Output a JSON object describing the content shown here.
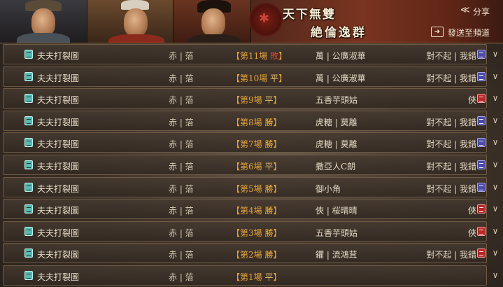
{
  "header": {
    "slogan_line1": "天下無雙",
    "slogan_line2": "絶倫逸群",
    "share_label": "分享",
    "send_label": "發送至頻道",
    "seal_glyph": "✱",
    "share_icon": "share-icon",
    "send_icon": "send-to-channel-icon"
  },
  "portraits": [
    "portrait-general-1",
    "portrait-general-2",
    "portrait-general-3"
  ],
  "rows": [
    {
      "name": "夫夫打裂圖",
      "host": "赤 | 菭",
      "match_prefix": "【第11場 ",
      "result": "敗",
      "result_type": "lose",
      "match_suffix": "】",
      "opponent": "萬 | 公廣淑華",
      "reply": "對不起 | 我錯",
      "badge": "blue"
    },
    {
      "name": "夫夫打裂圖",
      "host": "赤 | 菭",
      "match_prefix": "【第10場 ",
      "result": "平",
      "result_type": "draw",
      "match_suffix": "】",
      "opponent": "萬 | 公廣淑華",
      "reply": "對不起 | 我錯",
      "badge": "blue"
    },
    {
      "name": "夫夫打裂圖",
      "host": "赤 | 菭",
      "match_prefix": "【第9場 ",
      "result": "平",
      "result_type": "draw",
      "match_suffix": "】",
      "opponent": "五香芋頭姑",
      "reply": "俠",
      "badge": "red"
    },
    {
      "name": "夫夫打裂圖",
      "host": "赤 | 菭",
      "match_prefix": "【第8場 ",
      "result": "勝",
      "result_type": "win",
      "match_suffix": "】",
      "opponent": "虎糖 | 莫離",
      "reply": "對不起 | 我錯",
      "badge": "blue"
    },
    {
      "name": "夫夫打裂圖",
      "host": "赤 | 菭",
      "match_prefix": "【第7場 ",
      "result": "勝",
      "result_type": "win",
      "match_suffix": "】",
      "opponent": "虎糖 | 莫離",
      "reply": "對不起 | 我錯",
      "badge": "blue"
    },
    {
      "name": "夫夫打裂圖",
      "host": "赤 | 菭",
      "match_prefix": "【第6場 ",
      "result": "平",
      "result_type": "draw",
      "match_suffix": "】",
      "opponent": "撒亞人C朗",
      "reply": "對不起 | 我錯",
      "badge": "blue"
    },
    {
      "name": "夫夫打裂圖",
      "host": "赤 | 菭",
      "match_prefix": "【第5場 ",
      "result": "勝",
      "result_type": "win",
      "match_suffix": "】",
      "opponent": "御小角",
      "reply": "對不起 | 我錯",
      "badge": "blue"
    },
    {
      "name": "夫夫打裂圖",
      "host": "赤 | 菭",
      "match_prefix": "【第4場 ",
      "result": "勝",
      "result_type": "win",
      "match_suffix": "】",
      "opponent": "俠 | 桜晴晴",
      "reply": "俠",
      "badge": "red"
    },
    {
      "name": "夫夫打裂圖",
      "host": "赤 | 菭",
      "match_prefix": "【第3場 ",
      "result": "勝",
      "result_type": "win",
      "match_suffix": "】",
      "opponent": "五香芋頭姑",
      "reply": "俠",
      "badge": "red"
    },
    {
      "name": "夫夫打裂圖",
      "host": "赤 | 菭",
      "match_prefix": "【第2場 ",
      "result": "勝",
      "result_type": "win",
      "match_suffix": "】",
      "opponent": "鑺 | 流鴻茸",
      "reply": "對不起 | 我錯",
      "badge": "red"
    },
    {
      "name": "夫夫打裂圖",
      "host": "赤 | 菭",
      "match_prefix": "【第1場 ",
      "result": "平",
      "result_type": "draw",
      "match_suffix": "】",
      "opponent": "",
      "reply": "",
      "badge": ""
    }
  ],
  "expand_icon": "chevron-down-icon",
  "chevron_glyph": "∨",
  "colors": {
    "match_accent": "#e4a23a",
    "lose": "#e0402e",
    "row_border": "#6e5a44",
    "badge_blue": "#4a4aa8",
    "badge_red": "#b82626",
    "doc_icon": "#5ab8b2"
  }
}
